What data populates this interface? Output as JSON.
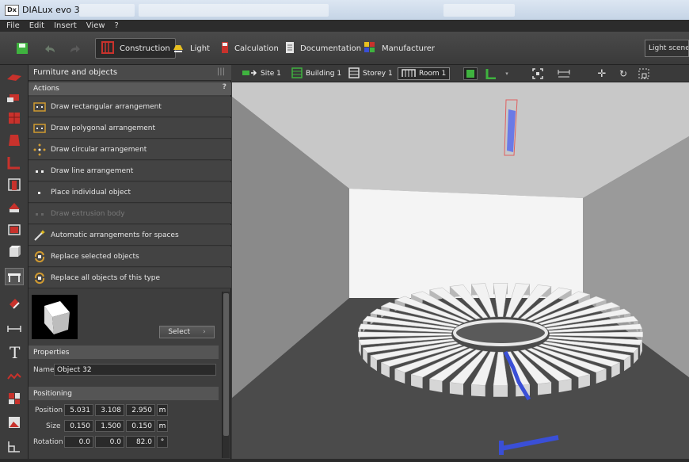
{
  "window": {
    "app_icon": "Dx",
    "title": "DIALux evo 3"
  },
  "menu": {
    "items": [
      "File",
      "Edit",
      "Insert",
      "View",
      "?"
    ]
  },
  "ribbon": {
    "tabs": [
      {
        "label": "Construction",
        "icon": "construction-icon",
        "active": true
      },
      {
        "label": "Light",
        "icon": "light-icon"
      },
      {
        "label": "Calculation",
        "icon": "calculation-icon"
      },
      {
        "label": "Documentation",
        "icon": "documentation-icon"
      },
      {
        "label": "Manufacturer",
        "icon": "manufacturer-icon"
      }
    ],
    "right_button": "Light scenes"
  },
  "panel": {
    "title": "Furniture and objects",
    "actions_header": "Actions",
    "help": "?",
    "actions": [
      {
        "label": "Draw rectangular arrangement",
        "icon": "rect-arrangement-icon"
      },
      {
        "label": "Draw polygonal arrangement",
        "icon": "polygon-arrangement-icon"
      },
      {
        "label": "Draw circular arrangement",
        "icon": "circular-arrangement-icon"
      },
      {
        "label": "Draw line arrangement",
        "icon": "line-arrangement-icon"
      },
      {
        "label": "Place individual object",
        "icon": "single-object-icon"
      },
      {
        "label": "Draw extrusion body",
        "icon": "extrusion-icon",
        "disabled": true
      },
      {
        "label": "Automatic arrangements for spaces",
        "icon": "magic-wand-icon"
      },
      {
        "label": "Replace selected objects",
        "icon": "replace-icon"
      },
      {
        "label": "Replace all objects of this type",
        "icon": "replace-all-icon"
      }
    ],
    "select_button": "Select",
    "properties": {
      "header": "Properties",
      "name_label": "Name",
      "name_value": "Object 32"
    },
    "positioning": {
      "header": "Positioning",
      "position_label": "Position",
      "position": [
        "5.031",
        "3.108",
        "2.950"
      ],
      "size_label": "Size",
      "size": [
        "0.150",
        "1.500",
        "0.150"
      ],
      "rotation_label": "Rotation",
      "rotation": [
        "0.0",
        "0.0",
        "82.0"
      ],
      "unit_m": "m",
      "unit_deg": "°"
    }
  },
  "breadcrumb": {
    "items": [
      {
        "label": "Site 1",
        "icon": "site-icon"
      },
      {
        "label": "Building 1",
        "icon": "building-icon"
      },
      {
        "label": "Storey 1",
        "icon": "storey-icon"
      },
      {
        "label": "Room 1",
        "icon": "room-icon",
        "active": true
      }
    ]
  },
  "colors": {
    "accent_red": "#c8322c",
    "accent_green": "#3fb33f",
    "selection_blue": "#3a4fd6"
  }
}
